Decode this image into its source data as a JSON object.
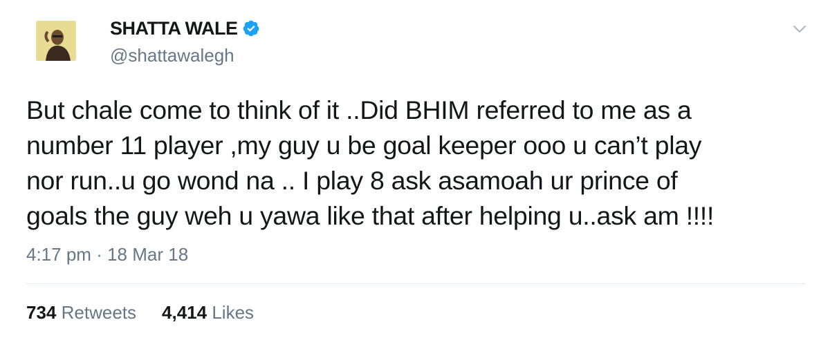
{
  "user": {
    "display_name": "SHATTA WALE",
    "handle": "@shattawalegh",
    "verified": true,
    "avatar_alt": "profile photo"
  },
  "tweet": {
    "lines": [
      "But chale come to think of it ..Did BHIM referred to me as a",
      "number 11 player ,my guy u be goal keeper ooo u can’t play",
      "nor run..u go wond na .. I play 8 ask asamoah ur prince of",
      "goals the guy weh u yawa like that after helping u..ask am !!!!"
    ],
    "time": "4:17 pm",
    "separator": "·",
    "date": "18 Mar 18"
  },
  "stats": {
    "retweets_count": "734",
    "retweets_label": "Retweets",
    "likes_count": "4,414",
    "likes_label": "Likes"
  },
  "colors": {
    "text": "#14171a",
    "secondary": "#657786",
    "verified_blue": "#1da1f2",
    "divider": "#e1e8ed"
  },
  "icons": {
    "verified": "verified-badge-icon",
    "caret": "chevron-down-icon"
  }
}
